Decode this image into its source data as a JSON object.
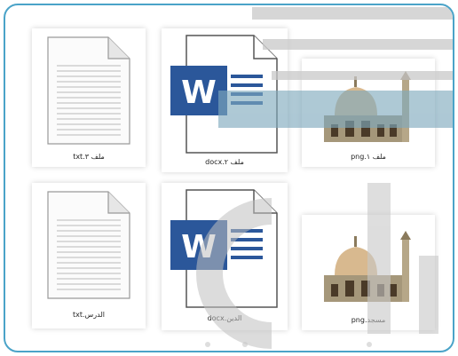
{
  "files": [
    {
      "name": "ملف ٣.txt",
      "type": "txt"
    },
    {
      "name": "ملف ٢.docx",
      "type": "docx"
    },
    {
      "name": "ملف ١.png",
      "type": "png"
    },
    {
      "name": "الدرس.txt",
      "type": "txt"
    },
    {
      "name": "الدين.docx",
      "type": "docx"
    },
    {
      "name": "مسجد.png",
      "type": "png"
    }
  ],
  "colors": {
    "frame_border": "#4aa3c8",
    "word_blue": "#2b579a",
    "watermark_gray": "#c8c8c8",
    "watermark_blue": "#7fa9bd"
  },
  "icons": {
    "txt": "text-document-icon",
    "docx": "word-document-icon",
    "png": "mosque-image-icon"
  }
}
